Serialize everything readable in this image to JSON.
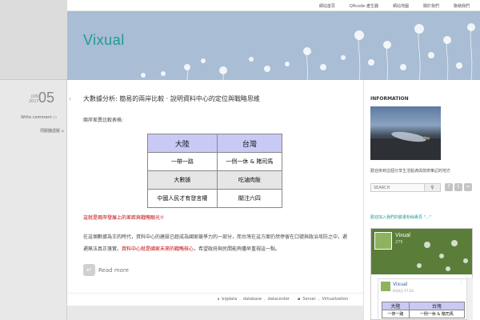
{
  "site": {
    "title": "Vixual"
  },
  "topnav": [
    "網站首頁",
    "QRcode 產生器",
    "網站地圖",
    "關於我們",
    "聯絡我們"
  ],
  "date": {
    "month": "JUN",
    "year": "2017",
    "day": "05"
  },
  "left": {
    "write_comment": "Write comment",
    "category": "伺服器虛擬"
  },
  "post": {
    "title": "大數據分析: 簡易的兩岸比較 · 說明資料中心的定位與戰略思維",
    "intro": "兩岸差異比較表格:",
    "table": {
      "headers": [
        "大陸",
        "台灣"
      ],
      "rows": [
        [
          "一帶一路",
          "一例一休 & 賭司馬"
        ],
        [
          "大數據",
          "吃滷肉飯"
        ],
        [
          "中國人民才有發言權",
          "關注六四"
        ]
      ]
    },
    "red_line": "這就是兩岸發展上的差距與戰略眼光!!",
    "paragraph": "在這個數據為王的時代，資料中心的建設已經成為國家競爭力的一部分，而台灣在這方面仍然停留在口號與政治攻防之中，遲遲無法真正落實。",
    "paragraph_red": "資料中心就是國家未來的戰略核心",
    "paragraph_end": "，希望政府與民間能夠儘早重視這一點。",
    "read_more": "Read more",
    "tags": [
      "bigdata",
      "database",
      "datacenter"
    ],
    "categories": [
      "Server",
      "Virtualization"
    ]
  },
  "sidebar": {
    "heading": "INFORMATION",
    "caption": "歡迎來到這個分享生活點滴與技術筆記的地方",
    "search_placeholder": "SEARCH",
    "fb_heading": "歡迎加入我們的臉書粉絲專頁 \"...\"",
    "fb": {
      "name": "Vixual",
      "count": "275",
      "post_name": "Vixual",
      "post_time": "6月6日 17:24",
      "table_headers": [
        "大陸",
        "台灣"
      ],
      "table_rows": [
        [
          "一帶一路",
          "一例一休 & 賭司馬"
        ]
      ]
    }
  },
  "colors": {
    "accent": "#1f9a96",
    "red": "#c00000",
    "table_header": "#c9c9f5",
    "header_bg": "#a9bdd4"
  }
}
